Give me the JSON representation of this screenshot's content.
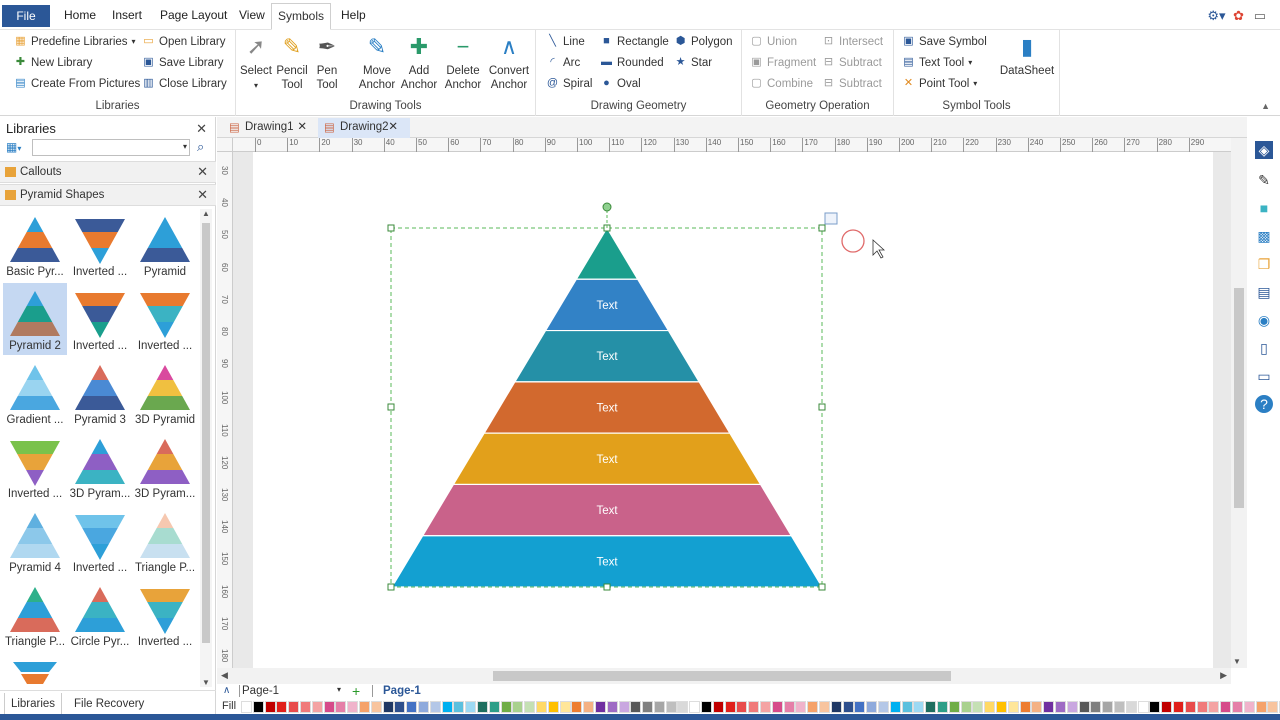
{
  "menu": {
    "file": "File",
    "home": "Home",
    "insert": "Insert",
    "page_layout": "Page Layout",
    "view": "View",
    "symbols": "Symbols",
    "help": "Help"
  },
  "ribbon": {
    "libraries": {
      "predefine": "Predefine Libraries",
      "open": "Open Library",
      "new": "New Library",
      "save": "Save Library",
      "create": "Create From Pictures",
      "close": "Close Library",
      "label": "Libraries"
    },
    "drawing_tools": {
      "select": "Select",
      "pencil": "Pencil",
      "pencil2": "Tool",
      "pen": "Pen",
      "pen2": "Tool",
      "move": "Move",
      "move2": "Anchor",
      "add": "Add",
      "add2": "Anchor",
      "delete": "Delete",
      "delete2": "Anchor",
      "convert": "Convert",
      "convert2": "Anchor",
      "label": "Drawing Tools"
    },
    "drawing_geometry": {
      "line": "Line",
      "arc": "Arc",
      "spiral": "Spiral",
      "rectangle": "Rectangle",
      "rounded": "Rounded",
      "oval": "Oval",
      "polygon": "Polygon",
      "star": "Star",
      "label": "Drawing Geometry"
    },
    "geometry_operation": {
      "union": "Union",
      "fragment": "Fragment",
      "combine": "Combine",
      "intersect": "Intersect",
      "subtract1": "Subtract",
      "subtract2": "Subtract",
      "label": "Geometry Operation"
    },
    "symbol_tools": {
      "save_symbol": "Save Symbol",
      "text_tool": "Text Tool",
      "point_tool": "Point Tool",
      "datasheet": "DataSheet",
      "label": "Symbol Tools"
    }
  },
  "sidebar": {
    "title": "Libraries",
    "sections": [
      "Callouts",
      "Pyramid Shapes"
    ],
    "shapes": [
      {
        "label": "Basic Pyr..."
      },
      {
        "label": "Inverted ..."
      },
      {
        "label": "Pyramid"
      },
      {
        "label": "Pyramid 2"
      },
      {
        "label": "Inverted ..."
      },
      {
        "label": "Inverted ..."
      },
      {
        "label": "Gradient ..."
      },
      {
        "label": "Pyramid 3"
      },
      {
        "label": "3D Pyramid"
      },
      {
        "label": "Inverted ..."
      },
      {
        "label": "3D Pyram..."
      },
      {
        "label": "3D Pyram..."
      },
      {
        "label": "Pyramid 4"
      },
      {
        "label": "Inverted ..."
      },
      {
        "label": "Triangle P..."
      },
      {
        "label": "Triangle P..."
      },
      {
        "label": "Circle Pyr..."
      },
      {
        "label": "Inverted ..."
      }
    ],
    "tabs": {
      "libraries": "Libraries",
      "file_recovery": "File Recovery"
    }
  },
  "doc_tabs": [
    "Drawing1",
    "Drawing2"
  ],
  "ruler_h": [
    "0",
    "10",
    "20",
    "30",
    "40",
    "50",
    "60",
    "70",
    "80",
    "90",
    "100",
    "110",
    "120",
    "130",
    "140",
    "150",
    "160",
    "170",
    "180",
    "190",
    "200",
    "210",
    "220",
    "230",
    "240",
    "250",
    "260",
    "270",
    "280",
    "290"
  ],
  "ruler_v": [
    "30",
    "40",
    "50",
    "60",
    "70",
    "80",
    "90",
    "100",
    "110",
    "120",
    "130",
    "140",
    "150",
    "160",
    "170",
    "180"
  ],
  "pyramid": {
    "levels": [
      {
        "text": "",
        "color": "#1a9e8c"
      },
      {
        "text": "Text",
        "color": "#3282c6"
      },
      {
        "text": "Text",
        "color": "#2590a7"
      },
      {
        "text": "Text",
        "color": "#d2692e"
      },
      {
        "text": "Text",
        "color": "#e2a01b"
      },
      {
        "text": "Text",
        "color": "#c9628a"
      },
      {
        "text": "Text",
        "color": "#13a0d1"
      }
    ]
  },
  "page_bar": {
    "page_select": "Page-1",
    "page_tab": "Page-1",
    "fill": "Fill"
  },
  "palette": [
    "#ffffff",
    "#000000",
    "#c00000",
    "#e0201b",
    "#e84c4c",
    "#f07a7a",
    "#f4a3a3",
    "#d64b8a",
    "#e57fa8",
    "#f0b3cb",
    "#f5a26a",
    "#f8c49e",
    "#203864",
    "#2e4f8c",
    "#4472c4",
    "#8faadc",
    "#b4c7e7",
    "#00b0f0",
    "#5bc0de",
    "#9dd9f3",
    "#1f6e5f",
    "#2e9e88",
    "#70ad47",
    "#a9d18e",
    "#c5e0b4",
    "#ffd966",
    "#ffc000",
    "#ffe699",
    "#ed7d31",
    "#f4b183",
    "#7030a0",
    "#9e6bc4",
    "#c9a7e0",
    "#595959",
    "#7f7f7f",
    "#a6a6a6",
    "#bfbfbf",
    "#d9d9d9"
  ]
}
